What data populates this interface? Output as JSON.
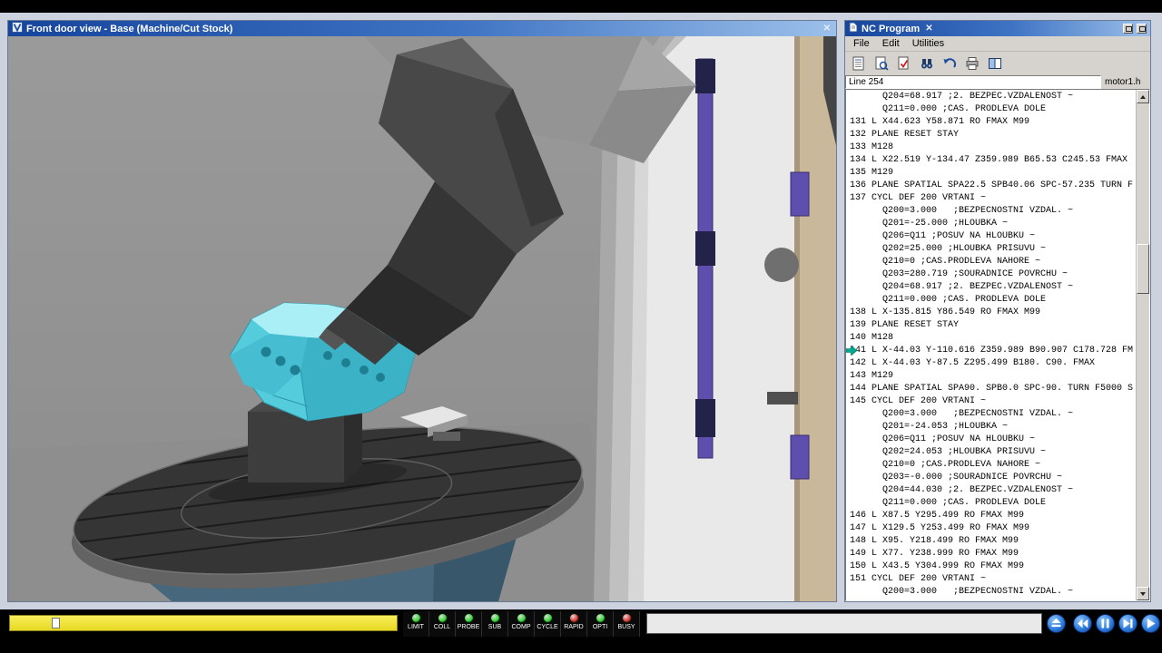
{
  "colors": {
    "titlebar_start": "#16459c",
    "titlebar_end": "#9cc0ea",
    "progress_yellow": "#f2e53a",
    "current_line_arrow": "#00a98f",
    "engine_part_cyan": "#54ccdc"
  },
  "view_window": {
    "title": "Front door view - Base (Machine/Cut Stock)",
    "close_glyph": "✕"
  },
  "nc_window": {
    "title": "NC Program",
    "close_glyph": "✕",
    "menus": [
      "File",
      "Edit",
      "Utilities"
    ],
    "toolbar_icons": [
      "open-program",
      "search-program",
      "syntax-check",
      "find",
      "undo",
      "print",
      "split-view"
    ],
    "line_field_value": "Line 254",
    "program_name": "motor1.h",
    "current_line_index": 20,
    "lines": [
      "      Q204=68.917 ;2. BEZPEC.VZDALENOST ~",
      "      Q211=0.000 ;CAS. PRODLEVA DOLE",
      "131 L X44.623 Y58.871 RO FMAX M99",
      "132 PLANE RESET STAY",
      "133 M128",
      "134 L X22.519 Y-134.47 Z359.989 B65.53 C245.53 FMAX",
      "135 M129",
      "136 PLANE SPATIAL SPA22.5 SPB40.06 SPC-57.235 TURN F",
      "137 CYCL DEF 200 VRTANI ~",
      "      Q200=3.000   ;BEZPECNOSTNI VZDAL. ~",
      "      Q201=-25.000 ;HLOUBKA ~",
      "      Q206=Q11 ;POSUV NA HLOUBKU ~",
      "      Q202=25.000 ;HLOUBKA PRISUVU ~",
      "      Q210=0 ;CAS.PRODLEVA NAHORE ~",
      "      Q203=280.719 ;SOURADNICE POVRCHU ~",
      "      Q204=68.917 ;2. BEZPEC.VZDALENOST ~",
      "      Q211=0.000 ;CAS. PRODLEVA DOLE",
      "138 L X-135.815 Y86.549 RO FMAX M99",
      "139 PLANE RESET STAY",
      "140 M128",
      "141 L X-44.03 Y-110.616 Z359.989 B90.907 C178.728 FM",
      "142 L X-44.03 Y-87.5 Z295.499 B180. C90. FMAX",
      "143 M129",
      "144 PLANE SPATIAL SPA90. SPB0.0 SPC-90. TURN F5000 S",
      "145 CYCL DEF 200 VRTANI ~",
      "      Q200=3.000   ;BEZPECNOSTNI VZDAL. ~",
      "      Q201=-24.053 ;HLOUBKA ~",
      "      Q206=Q11 ;POSUV NA HLOUBKU ~",
      "      Q202=24.053 ;HLOUBKA PRISUVU ~",
      "      Q210=0 ;CAS.PRODLEVA NAHORE ~",
      "      Q203=-0.000 ;SOURADNICE POVRCHU ~",
      "      Q204=44.030 ;2. BEZPEC.VZDALENOST ~",
      "      Q211=0.000 ;CAS. PRODLEVA DOLE",
      "146 L X87.5 Y295.499 RO FMAX M99",
      "147 L X129.5 Y253.499 RO FMAX M99",
      "148 L X95. Y218.499 RO FMAX M99",
      "149 L X77. Y238.999 RO FMAX M99",
      "150 L X43.5 Y304.999 RO FMAX M99",
      "151 CYCL DEF 200 VRTANI ~",
      "      Q200=3.000   ;BEZPECNOSTNI VZDAL. ~"
    ]
  },
  "status_lights": [
    {
      "label": "LIMIT",
      "color": "#33d433"
    },
    {
      "label": "COLL",
      "color": "#33d433"
    },
    {
      "label": "PROBE",
      "color": "#33d433"
    },
    {
      "label": "SUB",
      "color": "#33d433"
    },
    {
      "label": "COMP",
      "color": "#33d433"
    },
    {
      "label": "CYCLE",
      "color": "#33d433"
    },
    {
      "label": "RAPID",
      "color": "#e03030"
    },
    {
      "label": "OPTI",
      "color": "#33d433"
    },
    {
      "label": "BUSY",
      "color": "#e03030"
    }
  ],
  "transport_buttons": [
    {
      "name": "eject-button",
      "glyph": "eject"
    },
    {
      "name": "rewind-button",
      "glyph": "rewind"
    },
    {
      "name": "pause-button",
      "glyph": "pause"
    },
    {
      "name": "step-forward-button",
      "glyph": "step"
    },
    {
      "name": "play-button",
      "glyph": "play"
    }
  ]
}
